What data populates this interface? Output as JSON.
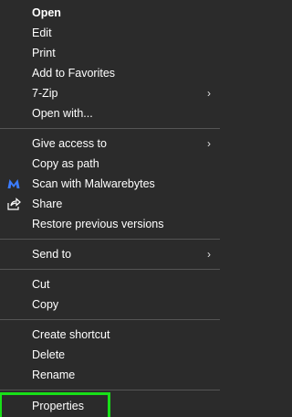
{
  "menu": {
    "items": [
      {
        "label": "Open"
      },
      {
        "label": "Edit"
      },
      {
        "label": "Print"
      },
      {
        "label": "Add to Favorites"
      },
      {
        "label": "7-Zip"
      },
      {
        "label": "Open with..."
      },
      {
        "label": "Give access to"
      },
      {
        "label": "Copy as path"
      },
      {
        "label": "Scan with Malwarebytes"
      },
      {
        "label": "Share"
      },
      {
        "label": "Restore previous versions"
      },
      {
        "label": "Send to"
      },
      {
        "label": "Cut"
      },
      {
        "label": "Copy"
      },
      {
        "label": "Create shortcut"
      },
      {
        "label": "Delete"
      },
      {
        "label": "Rename"
      },
      {
        "label": "Properties"
      }
    ],
    "submenu_arrow": "›"
  },
  "icons": {
    "malwarebytes": "malwarebytes-icon",
    "share": "share-icon"
  },
  "colors": {
    "background": "#2b2b2b",
    "separator": "#555555",
    "highlight_border": "#18e018",
    "malwarebytes_blue": "#3b7cff"
  }
}
